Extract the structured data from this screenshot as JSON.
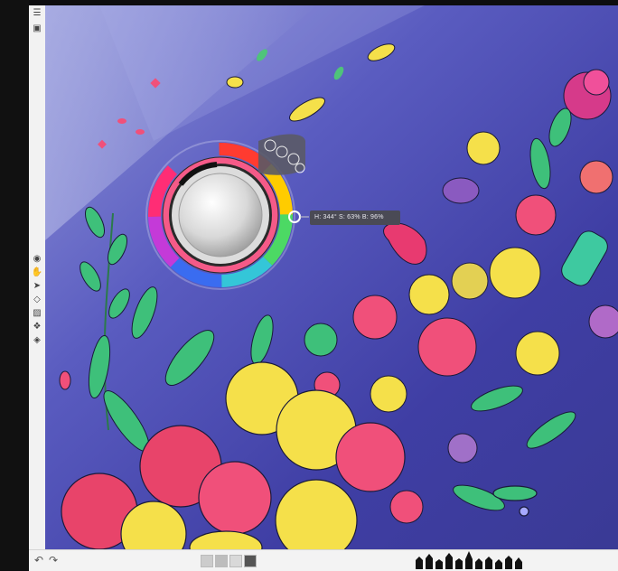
{
  "app": {
    "accent": "#e23a6a",
    "canvas_bg": "#3e3d98"
  },
  "toolbar": {
    "tools": [
      {
        "icon": "menu-icon",
        "glyph": "☰"
      },
      {
        "icon": "layers-panel-icon",
        "glyph": "▣"
      },
      {
        "icon": "eye-icon",
        "glyph": "◉"
      },
      {
        "icon": "hand-icon",
        "glyph": "✋"
      },
      {
        "icon": "select-arrow-icon",
        "glyph": "➤"
      },
      {
        "icon": "shape-icon",
        "glyph": "◇"
      },
      {
        "icon": "image-icon",
        "glyph": "▨"
      },
      {
        "icon": "layer-stack-icon",
        "glyph": "❖"
      },
      {
        "icon": "diamond-icon",
        "glyph": "◈"
      }
    ]
  },
  "color_picker": {
    "readout": "H: 344° S: 63% B: 96%",
    "hue": 344,
    "saturation": 63,
    "brightness": 96,
    "selected_color": "#f55a88",
    "mini_icons": [
      "palette-icon",
      "eyedropper-icon",
      "history-icon",
      "swatches-icon"
    ]
  },
  "bottombar": {
    "undo_glyph": "↶",
    "redo_glyph": "↷",
    "swatch_colors": [
      "#cccccc",
      "#bdbdbd",
      "#d9d9d9",
      "#555555"
    ],
    "brush_icons": [
      "brush-1-icon",
      "brush-2-icon",
      "brush-3-icon",
      "brush-4-icon",
      "brush-5-icon",
      "brush-6-icon",
      "brush-7-icon",
      "brush-8-icon",
      "brush-9-icon",
      "brush-10-icon",
      "brush-11-icon"
    ]
  }
}
